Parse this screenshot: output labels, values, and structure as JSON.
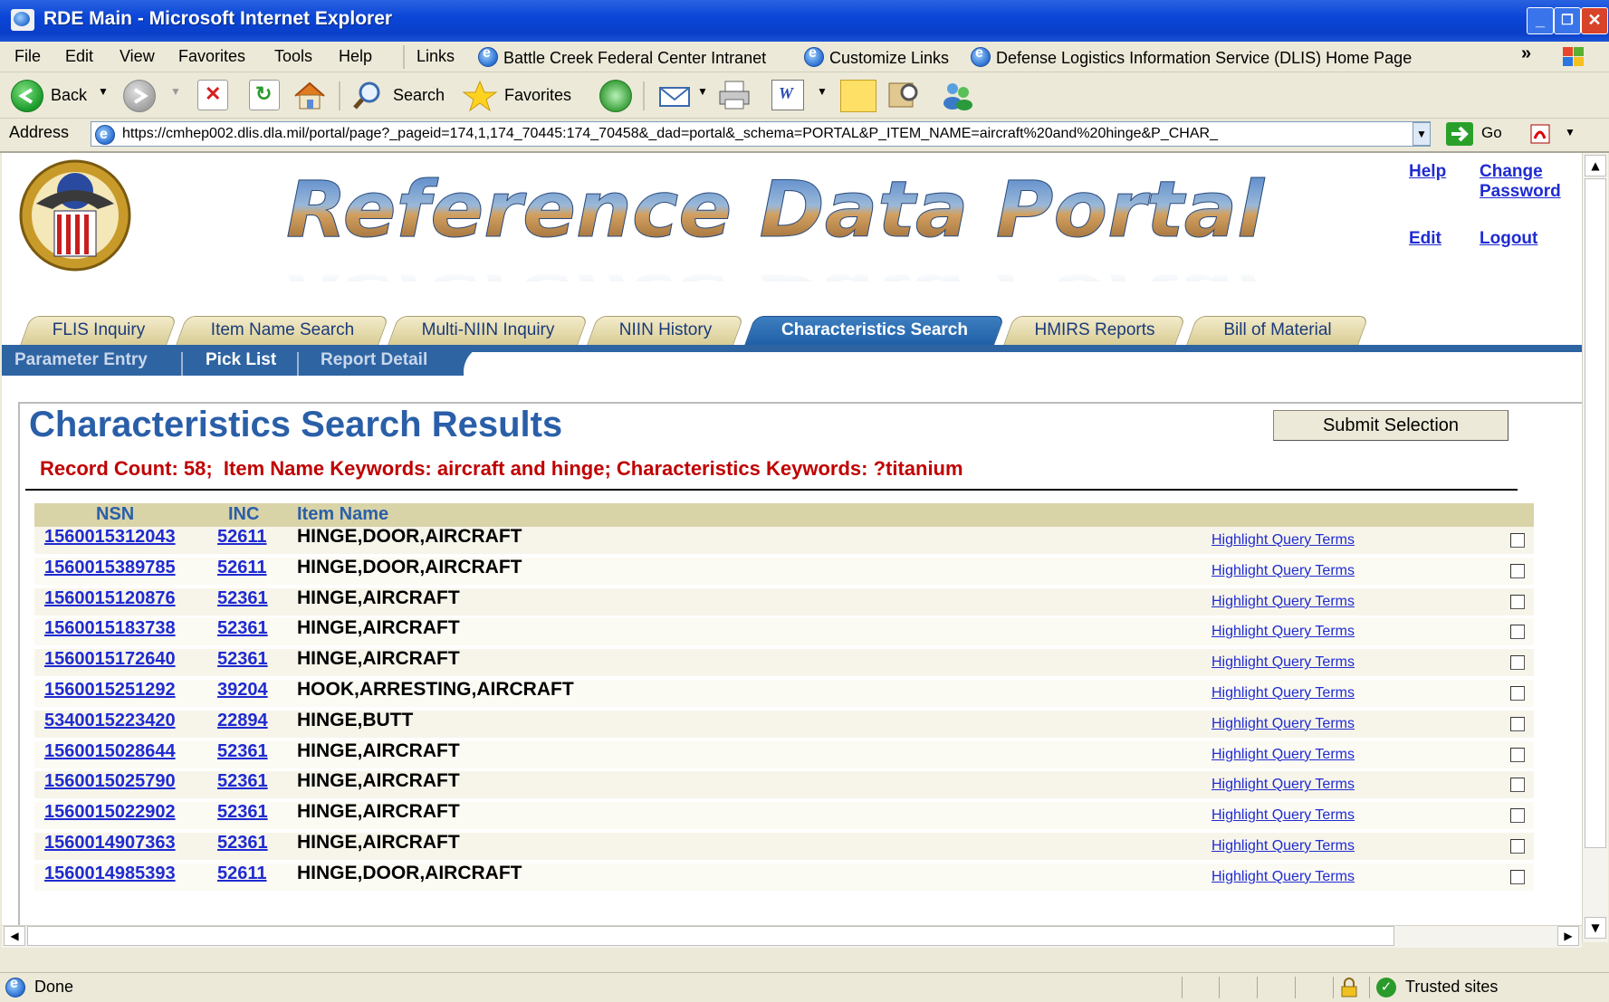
{
  "window": {
    "title": "RDE Main - Microsoft Internet Explorer",
    "min": "_",
    "max": "❐",
    "close": "✕"
  },
  "menu": {
    "items": [
      "File",
      "Edit",
      "View",
      "Favorites",
      "Tools",
      "Help"
    ]
  },
  "links": {
    "label": "Links",
    "items": [
      "Battle Creek Federal Center Intranet",
      "Customize Links",
      "Defense Logistics Information Service (DLIS) Home Page"
    ],
    "chevron": "»"
  },
  "toolbar": {
    "back": "Back",
    "search": "Search",
    "favorites": "Favorites"
  },
  "address": {
    "label": "Address",
    "url": "https://cmhep002.dlis.dla.mil/portal/page?_pageid=174,1,174_70445:174_70458&_dad=portal&_schema=PORTAL&P_ITEM_NAME=aircraft%20and%20hinge&P_CHAR_",
    "go": "Go"
  },
  "portal": {
    "banner": "Reference Data Portal",
    "help": "Help",
    "change_password": [
      "Change",
      "Password"
    ],
    "edit": "Edit",
    "logout": "Logout"
  },
  "tabs": [
    "FLIS Inquiry",
    "Item Name Search",
    "Multi-NIIN Inquiry",
    "NIIN History",
    "Characteristics Search",
    "HMIRS Reports",
    "Bill of Material"
  ],
  "subtabs": [
    "Parameter Entry",
    "Pick List",
    "Report Detail"
  ],
  "results": {
    "heading": "Characteristics Search Results",
    "submit": "Submit Selection",
    "summary": "Record Count: 58;  Item Name Keywords: aircraft and hinge; Characteristics Keywords: ?titanium",
    "columns": [
      "NSN",
      "INC",
      "Item Name"
    ],
    "highlight_label": "Highlight Query Terms",
    "rows": [
      {
        "nsn": "1560015312043",
        "inc": "52611",
        "name": "HINGE,DOOR,AIRCRAFT"
      },
      {
        "nsn": "1560015389785",
        "inc": "52611",
        "name": "HINGE,DOOR,AIRCRAFT"
      },
      {
        "nsn": "1560015120876",
        "inc": "52361",
        "name": "HINGE,AIRCRAFT"
      },
      {
        "nsn": "1560015183738",
        "inc": "52361",
        "name": "HINGE,AIRCRAFT"
      },
      {
        "nsn": "1560015172640",
        "inc": "52361",
        "name": "HINGE,AIRCRAFT"
      },
      {
        "nsn": "1560015251292",
        "inc": "39204",
        "name": "HOOK,ARRESTING,AIRCRAFT"
      },
      {
        "nsn": "5340015223420",
        "inc": "22894",
        "name": "HINGE,BUTT"
      },
      {
        "nsn": "1560015028644",
        "inc": "52361",
        "name": "HINGE,AIRCRAFT"
      },
      {
        "nsn": "1560015025790",
        "inc": "52361",
        "name": "HINGE,AIRCRAFT"
      },
      {
        "nsn": "1560015022902",
        "inc": "52361",
        "name": "HINGE,AIRCRAFT"
      },
      {
        "nsn": "1560014907363",
        "inc": "52361",
        "name": "HINGE,AIRCRAFT"
      },
      {
        "nsn": "1560014985393",
        "inc": "52611",
        "name": "HINGE,DOOR,AIRCRAFT"
      }
    ]
  },
  "status": {
    "text": "Done",
    "zone": "Trusted sites"
  }
}
